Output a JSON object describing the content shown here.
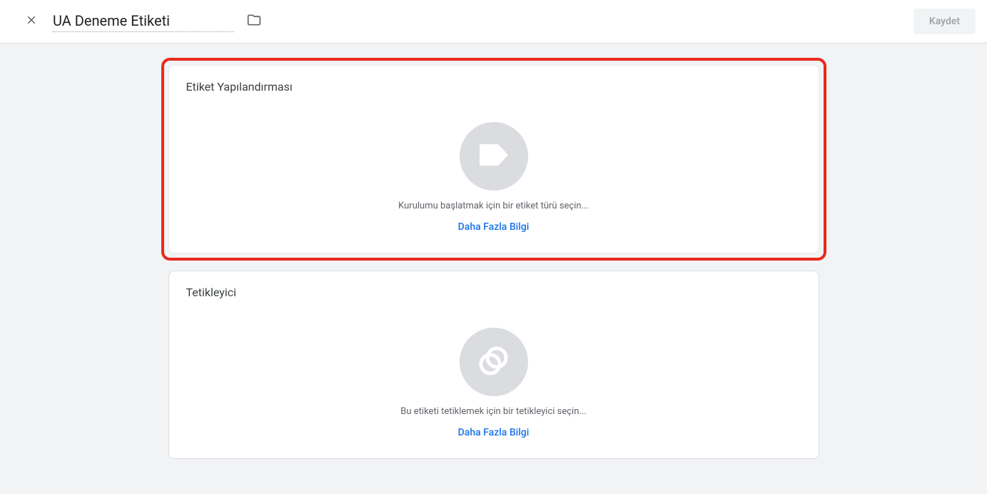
{
  "header": {
    "title_value": "UA Deneme Etiketi",
    "save_label": "Kaydet"
  },
  "tag_config": {
    "section_title": "Etiket Yapılandırması",
    "hint": "Kurulumu başlatmak için bir etiket türü seçin...",
    "learn_more": "Daha Fazla Bilgi"
  },
  "trigger": {
    "section_title": "Tetikleyici",
    "hint": "Bu etiketi tetiklemek için bir tetikleyici seçin...",
    "learn_more": "Daha Fazla Bilgi"
  },
  "colors": {
    "highlight": "#e8291c",
    "link": "#1a73e8"
  }
}
